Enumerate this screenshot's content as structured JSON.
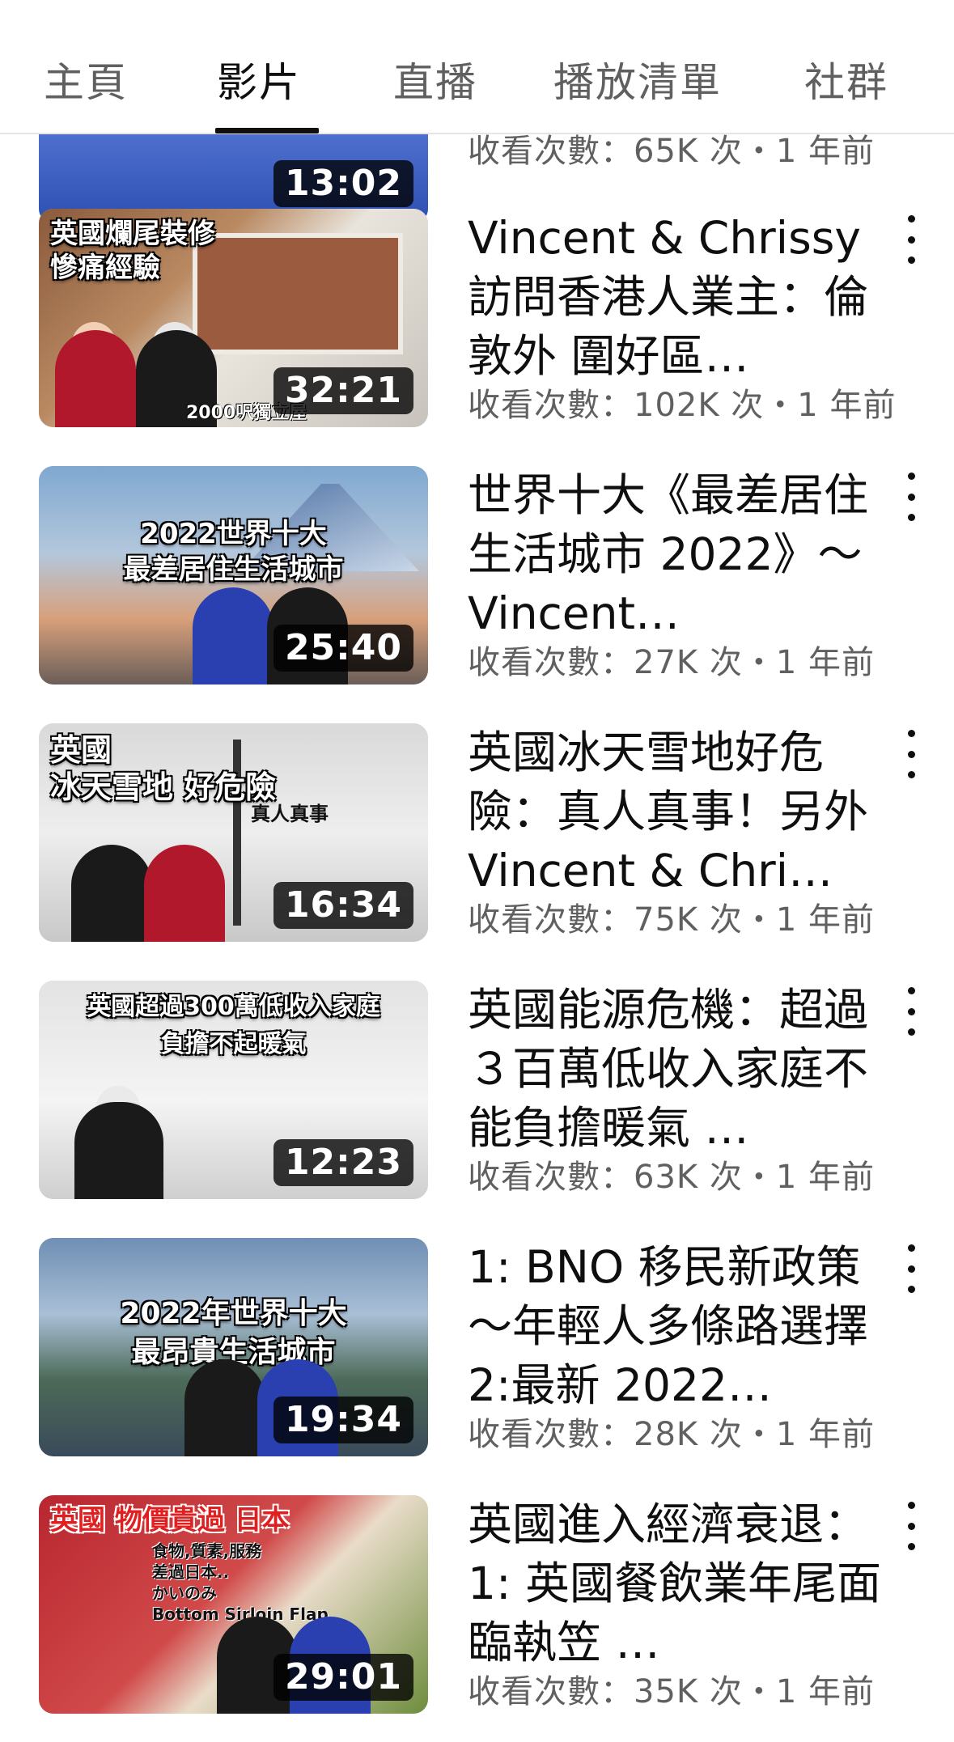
{
  "tabs": [
    {
      "label": "主頁"
    },
    {
      "label": "影片"
    },
    {
      "label": "直播"
    },
    {
      "label": "播放清單"
    },
    {
      "label": "社群"
    }
  ],
  "active_tab": "影片",
  "partial_video": {
    "duration": "13:02",
    "meta": "收看次數：65K 次・1 年前"
  },
  "videos": [
    {
      "title": "Vincent & Chrissy 訪問香港人業主：倫敦外  圍好區…",
      "meta": "收看次數：102K 次・1 年前",
      "duration": "32:21",
      "thumb_text": "英國爛尾裝修\n慘痛經驗",
      "thumb_subtext": "2000呎獨立屋"
    },
    {
      "title": "世界十大《最差居住生活城市 2022》～ Vincent…",
      "meta": "收看次數：27K 次・1 年前",
      "duration": "25:40",
      "thumb_text": "2022世界十大\n最差居住生活城市",
      "thumb_subtext": ""
    },
    {
      "title": "英國冰天雪地好危險：真人真事！另外 Vincent & Chri…",
      "meta": "收看次數：75K 次・1 年前",
      "duration": "16:34",
      "thumb_text": "英國\n冰天雪地 好危險",
      "thumb_subtext": "真人真事"
    },
    {
      "title": "英國能源危機：超過３百萬低收入家庭不能負擔暖氣  …",
      "meta": "收看次數：63K 次・1 年前",
      "duration": "12:23",
      "thumb_text": "英國超過300萬低收入家庭\n負擔不起暖氣",
      "thumb_subtext": ""
    },
    {
      "title": "1: BNO 移民新政策  ～年輕人多條路選擇 2:最新 2022…",
      "meta": "收看次數：28K 次・1 年前",
      "duration": "19:34",
      "thumb_text": "2022年世界十大\n最昂貴生活城市",
      "thumb_subtext": ""
    },
    {
      "title": "英國進入經濟衰退：  1: 英國餐飲業年尾面臨執笠  …",
      "meta": "收看次數：35K 次・1 年前",
      "duration": "29:01",
      "thumb_text": "英國 物價貴過 日本",
      "thumb_subtext": "食物,質素,服務\n差過日本..\nかいのみ\nBottom Sirloin Flap"
    }
  ],
  "colors": {
    "text_primary": "#0f0f0f",
    "text_secondary": "#606060",
    "duration_bg": "#000000"
  }
}
